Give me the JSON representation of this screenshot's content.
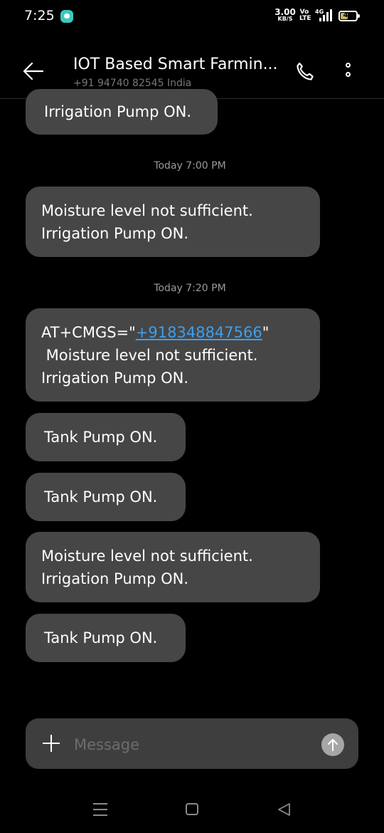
{
  "status_bar": {
    "time": "7:25",
    "net_speed_value": "3.00",
    "net_speed_unit": "KB/S",
    "volte_top": "Vo",
    "volte_bottom": "LTE",
    "network_type": "4G",
    "battery_level": "44",
    "battery_fraction": 0.44,
    "notification_icon": "message-bubble-icon"
  },
  "header": {
    "contact_name": "IOT Based Smart Farmin...",
    "contact_subtitle": "+91 94740 82545  India",
    "back_icon": "arrow-left-icon",
    "call_icon": "phone-icon",
    "more_icon": "more-vertical-icon"
  },
  "messages": [
    {
      "type": "bubble",
      "lines": [
        "Irrigation Pump ON."
      ]
    },
    {
      "type": "timestamp",
      "text": "Today 7:00 PM"
    },
    {
      "type": "bubble",
      "lines": [
        "Moisture level not sufficient.",
        "Irrigation Pump ON."
      ]
    },
    {
      "type": "timestamp",
      "text": "Today 7:20 PM"
    },
    {
      "type": "bubble",
      "line1_prefix": "AT+CMGS=\"",
      "phone_link": "+918348847566",
      "line1_suffix": "\"",
      "lines": [
        " Moisture level not sufficient.",
        "Irrigation Pump ON."
      ]
    },
    {
      "type": "bubble",
      "lines": [
        "Tank Pump ON."
      ]
    },
    {
      "type": "bubble",
      "lines": [
        "Tank Pump ON."
      ]
    },
    {
      "type": "bubble",
      "lines": [
        "Moisture level not sufficient.",
        "Irrigation Pump ON."
      ]
    },
    {
      "type": "bubble",
      "lines": [
        "Tank Pump ON."
      ]
    }
  ],
  "compose": {
    "placeholder": "Message",
    "value": "",
    "attach_icon": "plus-icon",
    "send_icon": "arrow-up-icon"
  },
  "nav_bar": {
    "recents_icon": "recents-icon",
    "home_icon": "home-icon",
    "back_icon": "triangle-back-icon"
  },
  "colors": {
    "background": "#000000",
    "bubble": "#464646",
    "link": "#3d9ff0",
    "timestamp": "#9a9a9a",
    "compose_bg": "#3e3e3e",
    "send_button": "#a6a6a6"
  }
}
